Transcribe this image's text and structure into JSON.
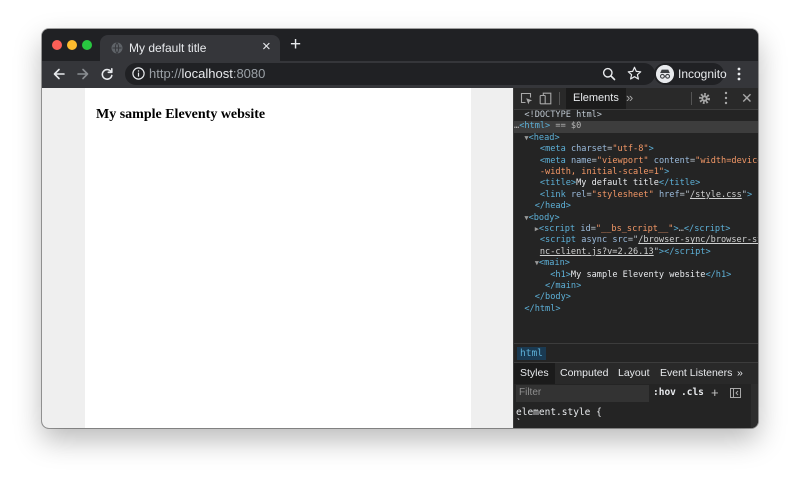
{
  "tab": {
    "title": "My default title",
    "close": "×"
  },
  "newtab": "+",
  "address": {
    "host_prefix": "http://",
    "host": "localhost",
    "port": ":8080"
  },
  "profile": {
    "label": "Incognito"
  },
  "page": {
    "h1": "My sample Eleventy website"
  },
  "devtools": {
    "panel_tab": "Elements",
    "more_tabs": "»",
    "close": "✕",
    "dom": {
      "doctype": "<!DOCTYPE html>",
      "html_open": "<html>",
      "selected_suffix": " == $0",
      "head_open": "<head>",
      "meta1_name": "meta",
      "meta1_attr": "charset",
      "meta1_val": "\"utf-8\"",
      "meta2_attr_name": "name",
      "meta2_attr_name_val": "\"viewport\"",
      "meta2_attr_content": "content",
      "meta2_val_a": "\"width=device",
      "meta2_val_b": "-width, initial-scale=1\"",
      "title_text": "My default title",
      "link_rel_val": "\"stylesheet\"",
      "link_href_val": "/style.css",
      "head_close": "</head>",
      "body_open": "<body>",
      "script1_id_val": "\"__bs_script__\"",
      "script1_ellipsis": "…",
      "script2_src_a": "/browser-sync/browser-sy",
      "script2_src_b": "nc-client.js?v=2.26.13",
      "main_open": "<main>",
      "h1_text": "My sample Eleventy website",
      "main_close": "</main>",
      "body_close": "</body>",
      "html_close": "</html>"
    },
    "breadcrumb": "html",
    "subtabs": [
      "Styles",
      "Computed",
      "Layout",
      "Event Listeners"
    ],
    "subtabs_more": "»",
    "filter_placeholder": "Filter",
    "hov": ":hov",
    "cls": ".cls",
    "add_rule": "+",
    "style_rule": "element.style {\n`"
  },
  "colors": {
    "chrome_frame": "#202124",
    "chrome_toolbar": "#35363a",
    "devtools_bg": "#242424",
    "tag_blue": "#5db0d7",
    "attr_value_orange": "#f29766"
  }
}
